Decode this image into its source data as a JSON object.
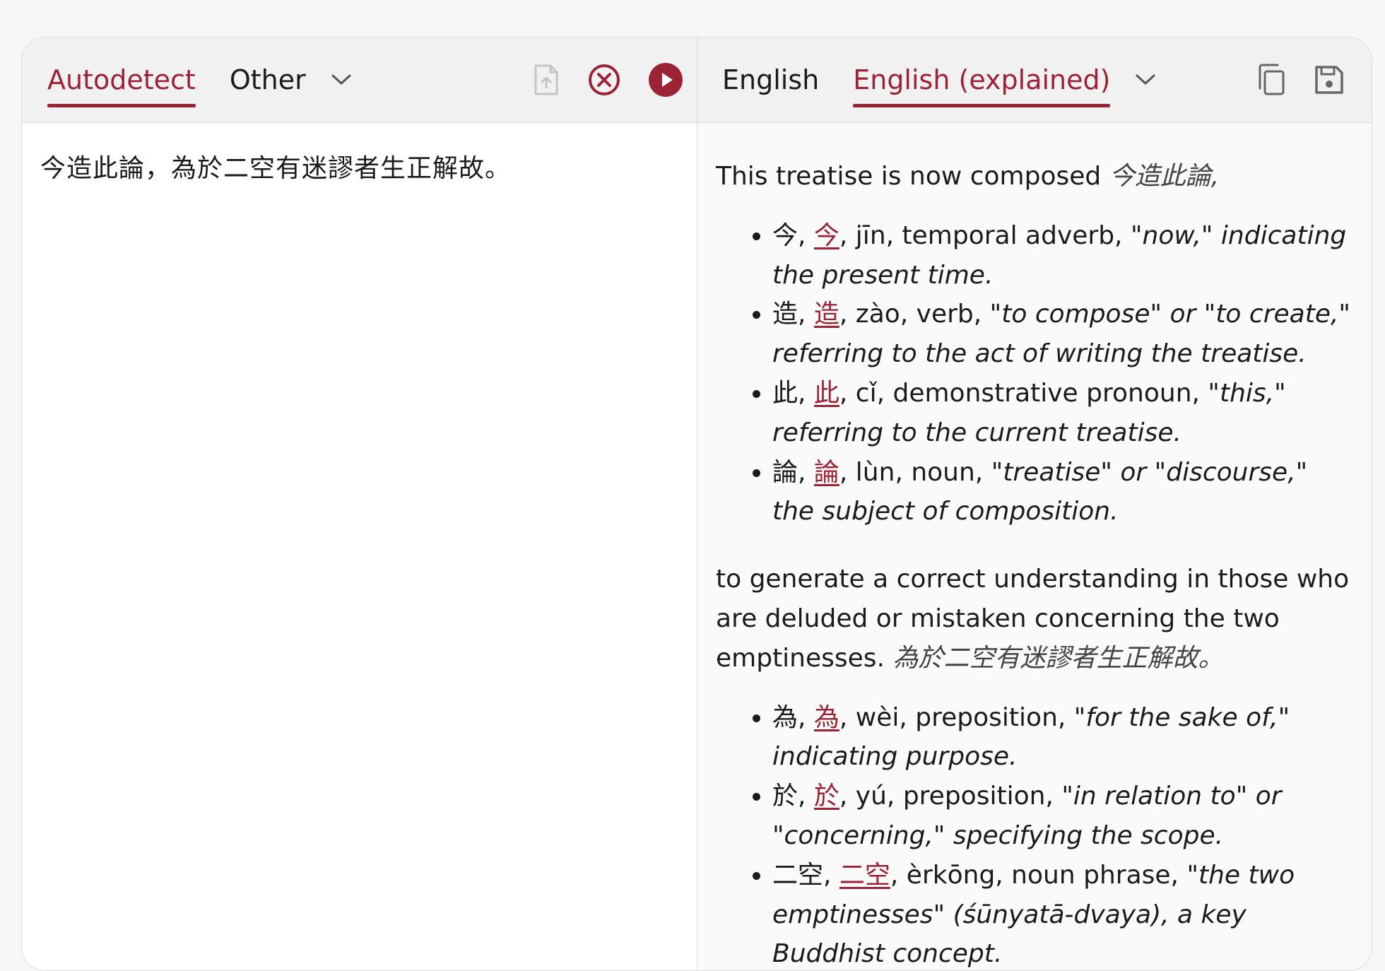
{
  "colors": {
    "accent": "#9b2335",
    "panel": "#f1f1f1",
    "border": "#dcdcdc"
  },
  "source": {
    "tabs": [
      {
        "label": "Autodetect",
        "active": true
      },
      {
        "label": "Other",
        "active": false
      }
    ],
    "icons": [
      "chevron-down-icon",
      "upload-file-icon",
      "clear-icon",
      "play-icon"
    ],
    "text": "今造此論，為於二空有迷謬者生正解故。"
  },
  "target": {
    "tabs": [
      {
        "label": "English",
        "active": false
      },
      {
        "label": "English (explained)",
        "active": true
      }
    ],
    "icons": [
      "chevron-down-icon",
      "copy-icon",
      "save-icon"
    ],
    "sections": [
      {
        "sentence": "This treatise is now composed",
        "source": "今造此論,",
        "terms": [
          {
            "char": "今",
            "link": "今",
            "rest": ", jīn, temporal adverb, ",
            "gloss": "\"now,\" indicating the present time."
          },
          {
            "char": "造",
            "link": "造",
            "rest": ", zào, verb, ",
            "gloss": "\"to compose\" or \"to create,\" referring to the act of writing the treatise."
          },
          {
            "char": "此",
            "link": "此",
            "rest": ", cǐ, demonstrative pronoun, ",
            "gloss": "\"this,\" referring to the current treatise."
          },
          {
            "char": "論",
            "link": "論",
            "rest": ", lùn, noun, ",
            "gloss": "\"treatise\" or \"discourse,\" the subject of composition."
          }
        ]
      },
      {
        "sentence": "to generate a correct understanding in those who are deluded or mistaken concerning the two emptinesses.",
        "source": "為於二空有迷謬者生正解故。",
        "terms": [
          {
            "char": "為",
            "link": "為",
            "rest": ", wèi, preposition, ",
            "gloss": "\"for the sake of,\" indicating purpose."
          },
          {
            "char": "於",
            "link": "於",
            "rest": ", yú, preposition, ",
            "gloss": "\"in relation to\" or \"concerning,\" specifying the scope."
          },
          {
            "char": "二空",
            "link": "二空",
            "rest": ", èrkōng, noun phrase, ",
            "gloss": "\"the two emptinesses\" (śūnyatā-dvaya), a key Buddhist concept."
          }
        ]
      }
    ]
  }
}
